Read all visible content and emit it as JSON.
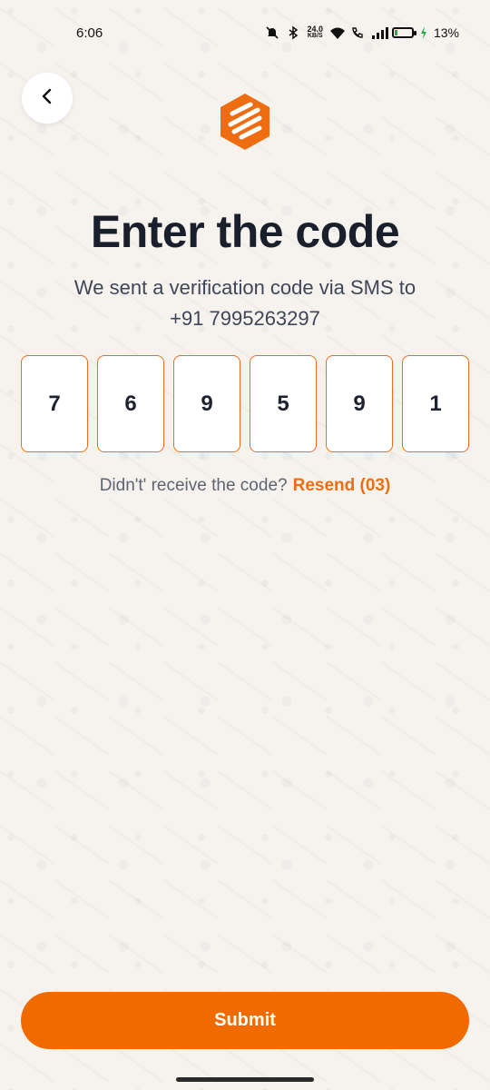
{
  "status_bar": {
    "time": "6:06",
    "speed_value": "24.0",
    "speed_unit": "KB/S",
    "battery": "13%",
    "icons": [
      "mute-icon",
      "bluetooth-icon",
      "wifi-icon",
      "wifi-call-icon",
      "signal-icon",
      "battery-icon",
      "charging-icon"
    ]
  },
  "nav": {
    "back_icon": "chevron-left-icon"
  },
  "logo": {
    "icon": "brand-logo-icon",
    "color": "#ef6d11"
  },
  "header": {
    "title": "Enter the code",
    "subtitle_line1": "We sent a verification code via SMS to",
    "subtitle_line2": "+91 7995263297"
  },
  "otp": {
    "digits": [
      "7",
      "6",
      "9",
      "5",
      "9",
      "1"
    ]
  },
  "resend": {
    "prompt": "Didn't' receive the code?",
    "link": "Resend (03)"
  },
  "actions": {
    "submit_label": "Submit"
  },
  "colors": {
    "accent": "#f16a00",
    "background": "#f6f3ef",
    "title": "#1a1f2c"
  }
}
